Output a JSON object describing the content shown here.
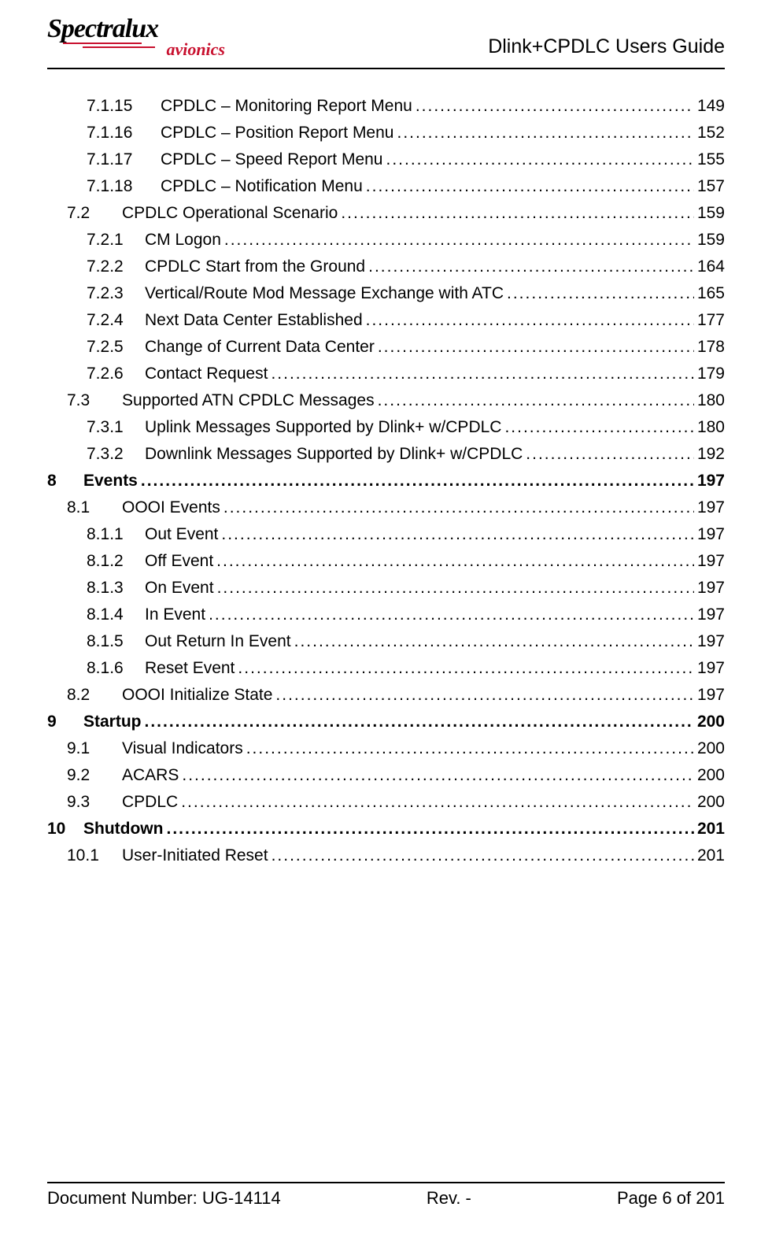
{
  "header": {
    "logo_main": "Spectralux",
    "logo_sub": "avionics",
    "title": "Dlink+CPDLC Users Guide"
  },
  "toc": [
    {
      "level": 3,
      "number": "7.1.15",
      "title": "CPDLC – Monitoring Report Menu",
      "page": "149"
    },
    {
      "level": 3,
      "number": "7.1.16",
      "title": "CPDLC – Position Report Menu",
      "page": "152"
    },
    {
      "level": 3,
      "number": "7.1.17",
      "title": "CPDLC – Speed Report Menu",
      "page": "155"
    },
    {
      "level": 3,
      "number": "7.1.18",
      "title": "CPDLC – Notification Menu",
      "page": "157"
    },
    {
      "level": 1,
      "number": "7.2",
      "title": "CPDLC Operational Scenario",
      "page": "159"
    },
    {
      "level": 2,
      "number": "7.2.1",
      "title": "CM Logon",
      "page": "159"
    },
    {
      "level": 2,
      "number": "7.2.2",
      "title": "CPDLC Start from the Ground",
      "page": "164"
    },
    {
      "level": 2,
      "number": "7.2.3",
      "title": "Vertical/Route Mod Message Exchange with ATC",
      "page": "165"
    },
    {
      "level": 2,
      "number": "7.2.4",
      "title": "Next Data Center Established",
      "page": "177"
    },
    {
      "level": 2,
      "number": "7.2.5",
      "title": "Change of Current Data Center",
      "page": "178"
    },
    {
      "level": 2,
      "number": "7.2.6",
      "title": "Contact Request",
      "page": "179"
    },
    {
      "level": 1,
      "number": "7.3",
      "title": "Supported ATN CPDLC Messages",
      "page": "180"
    },
    {
      "level": 2,
      "number": "7.3.1",
      "title": "Uplink Messages Supported by Dlink+ w/CPDLC",
      "page": "180"
    },
    {
      "level": 2,
      "number": "7.3.2",
      "title": "Downlink Messages Supported by Dlink+ w/CPDLC",
      "page": "192"
    },
    {
      "level": 0,
      "number": "8",
      "title": "Events",
      "page": "197"
    },
    {
      "level": 1,
      "number": "8.1",
      "title": "OOOI Events",
      "page": "197"
    },
    {
      "level": 2,
      "number": "8.1.1",
      "title": "Out Event",
      "page": "197"
    },
    {
      "level": 2,
      "number": "8.1.2",
      "title": "Off Event",
      "page": "197"
    },
    {
      "level": 2,
      "number": "8.1.3",
      "title": "On Event",
      "page": "197"
    },
    {
      "level": 2,
      "number": "8.1.4",
      "title": "In Event",
      "page": "197"
    },
    {
      "level": 2,
      "number": "8.1.5",
      "title": "Out Return In Event",
      "page": "197"
    },
    {
      "level": 2,
      "number": "8.1.6",
      "title": "Reset Event",
      "page": "197"
    },
    {
      "level": 1,
      "number": "8.2",
      "title": "OOOI Initialize State",
      "page": "197"
    },
    {
      "level": 0,
      "number": "9",
      "title": "Startup",
      "page": "200"
    },
    {
      "level": 1,
      "number": "9.1",
      "title": "Visual Indicators",
      "page": "200"
    },
    {
      "level": 1,
      "number": "9.2",
      "title": "ACARS",
      "page": "200"
    },
    {
      "level": 1,
      "number": "9.3",
      "title": "CPDLC",
      "page": "200"
    },
    {
      "level": 0,
      "number": "10",
      "title": "Shutdown",
      "page": "201"
    },
    {
      "level": 1,
      "number": "10.1",
      "title": "User-Initiated Reset",
      "page": "201"
    }
  ],
  "footer": {
    "doc_number_label": "Document Number:  UG-14114",
    "revision": "Rev. -",
    "page_label": "Page 6 of 201"
  }
}
